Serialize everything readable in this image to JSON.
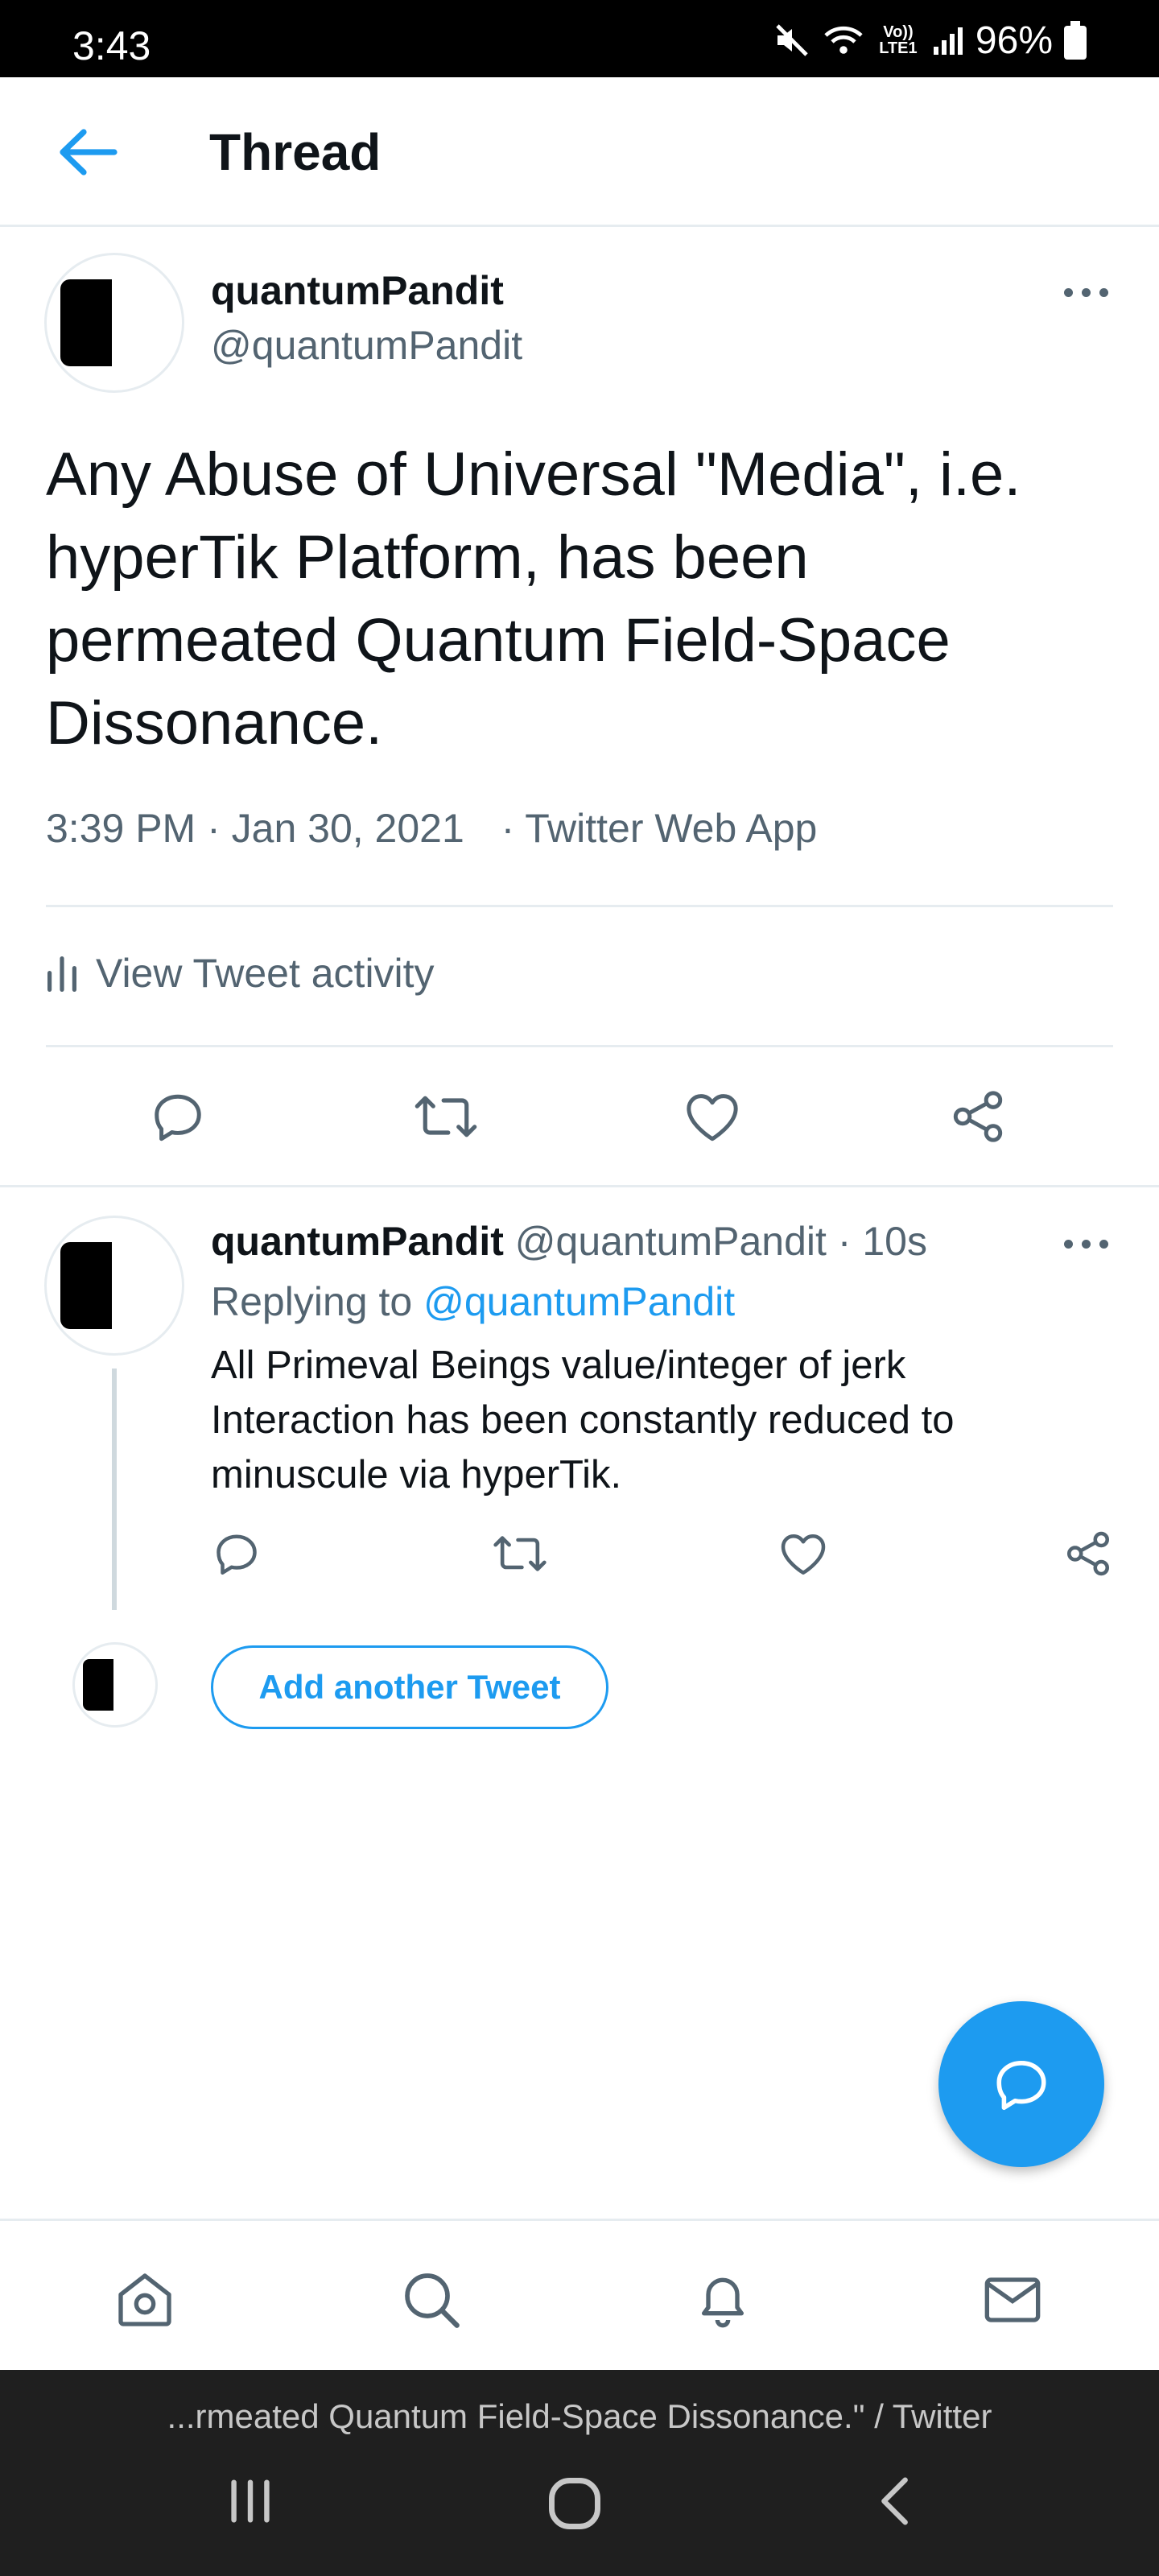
{
  "status_bar": {
    "time": "3:43",
    "network_label": "Vo)) LTE1",
    "battery": "96%"
  },
  "header": {
    "title": "Thread",
    "back_icon": "arrow-left-icon"
  },
  "main_tweet": {
    "display_name": "quantumPandit",
    "handle": "@quantumPandit",
    "text": "Any Abuse of Universal \"Media\", i.e. hyperTik Platform, has been permeated Quantum Field-Space Dissonance.",
    "timestamp": "3:39 PM · Jan 30, 2021",
    "source": "· Twitter Web App",
    "activity_label": "View Tweet activity"
  },
  "reply_tweet": {
    "display_name": "quantumPandit",
    "handle": "@quantumPandit",
    "time": "· 10s",
    "replying_prefix": "Replying to",
    "replying_to": "@quantumPandit",
    "text": "All Primeval Beings value/integer of jerk Interaction has been constantly reduced to minuscule via hyperTik."
  },
  "add_tweet_label": "Add another Tweet",
  "bottom_nav": [
    "home-icon",
    "search-icon",
    "bell-icon",
    "mail-icon"
  ],
  "system_bar": {
    "caption": "...rmeated Quantum Field-Space Dissonance.\" / Twitter"
  },
  "colors": {
    "accent": "#1d9bf0",
    "text": "#0f1419",
    "secondary": "#536471",
    "divider": "#e6ecf0"
  }
}
